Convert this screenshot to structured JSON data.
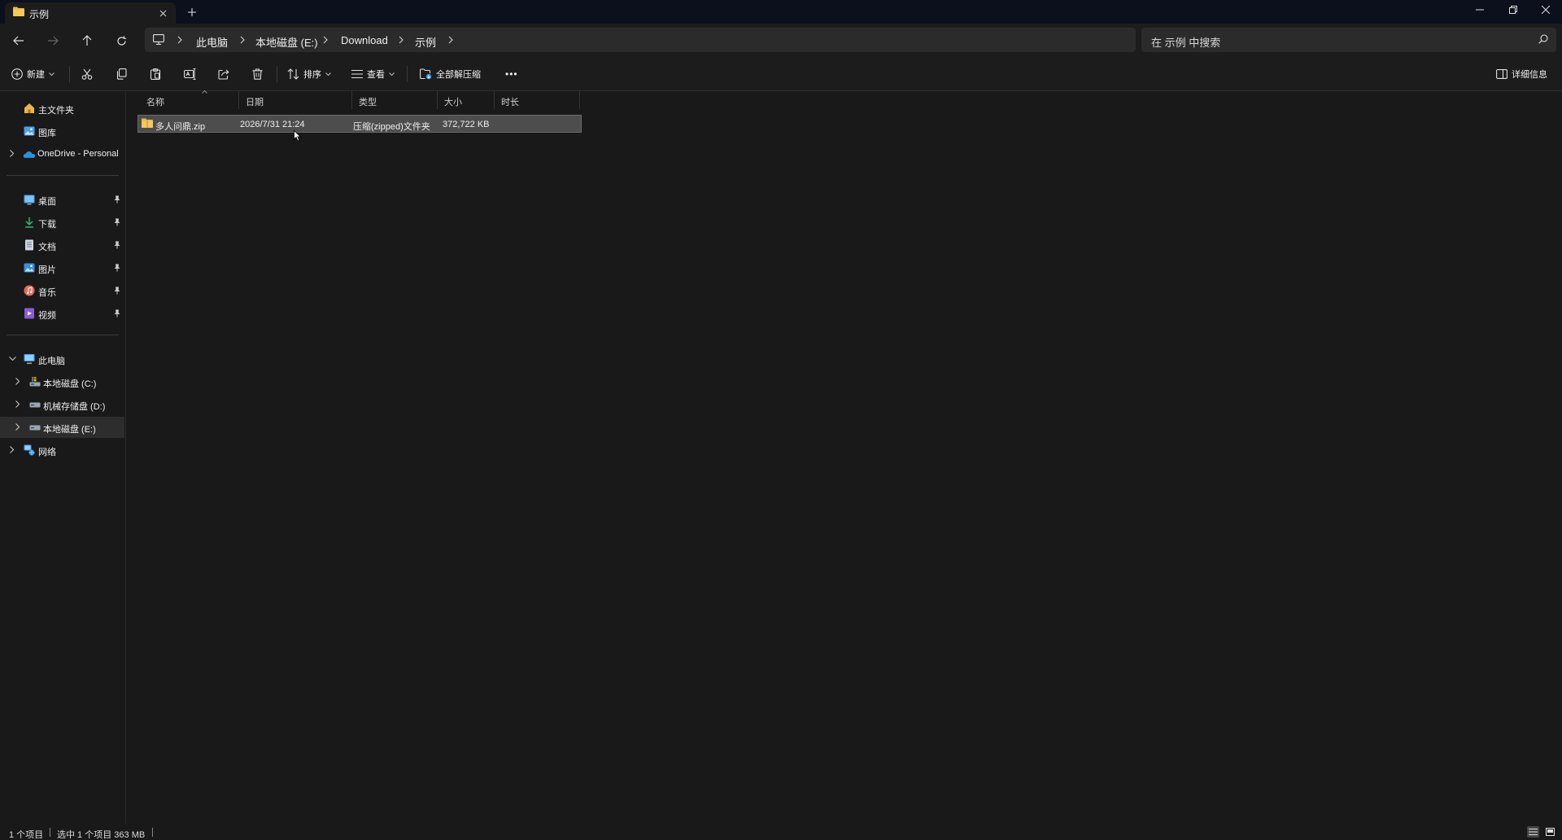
{
  "tab": {
    "title": "示例",
    "close_symbol": "✕",
    "new_symbol": "+"
  },
  "address": {
    "breadcrumb": [
      "此电脑",
      "本地磁盘 (E:)",
      "Download",
      "示例"
    ],
    "search_placeholder": "在 示例 中搜索"
  },
  "commands": {
    "new_label": "新建",
    "sort_label": "排序",
    "view_label": "查看",
    "extract_all_label": "全部解压缩",
    "more_label": "•••",
    "details_label": "详细信息"
  },
  "sidebar": {
    "quick": [
      {
        "label": "主文件夹",
        "icon": "home-icon"
      },
      {
        "label": "图库",
        "icon": "gallery-icon"
      },
      {
        "label": "OneDrive - Personal",
        "icon": "onedrive-icon"
      }
    ],
    "pinned": [
      {
        "label": "桌面",
        "icon": "desktop-icon"
      },
      {
        "label": "下载",
        "icon": "download-icon"
      },
      {
        "label": "文档",
        "icon": "document-icon"
      },
      {
        "label": "图片",
        "icon": "pictures-icon"
      },
      {
        "label": "音乐",
        "icon": "music-icon"
      },
      {
        "label": "视频",
        "icon": "video-icon"
      }
    ],
    "this_pc": "此电脑",
    "drives": [
      {
        "label": "本地磁盘 (C:)",
        "icon": "system-drive-icon"
      },
      {
        "label": "机械存储盘 (D:)",
        "icon": "drive-icon"
      },
      {
        "label": "本地磁盘 (E:)",
        "icon": "drive-icon",
        "selected": true
      }
    ],
    "network": "网络"
  },
  "columns": [
    "名称",
    "日期",
    "类型",
    "大小",
    "时长"
  ],
  "files": [
    {
      "name": "多人问鼎.zip",
      "date": "2026/7/31 21:24",
      "type": "压缩(zipped)文件夹",
      "size": "372,722 KB",
      "duration": ""
    }
  ],
  "status": {
    "items_count": "1 个项目",
    "selected": "选中 1 个项目  363 MB"
  },
  "colors": {
    "titlebar": "#0c0f1c",
    "background": "#191919",
    "toolbar": "#1c1c1c",
    "selection": "#4d4d4d",
    "folder_yellow": "#e8b84a",
    "onedrive_blue": "#2b8fe0"
  }
}
